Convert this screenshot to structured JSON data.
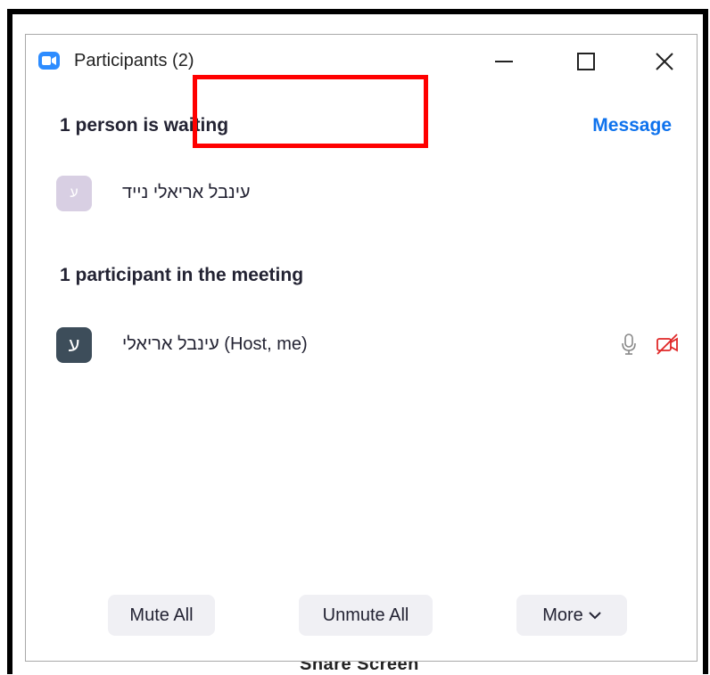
{
  "background_label": "Share Screen",
  "window": {
    "title": "Participants (2)"
  },
  "waiting": {
    "heading": "1 person is waiting",
    "message_label": "Message",
    "participants": [
      {
        "avatar_letter": "ע",
        "name": "עינבל אריאלי נייד"
      }
    ]
  },
  "meeting": {
    "heading": "1 participant in the meeting",
    "participants": [
      {
        "avatar_letter": "ע",
        "name": "עינבל אריאלי (Host, me)",
        "mic": "muted-mic-icon",
        "video": "video-off-icon"
      }
    ]
  },
  "footer": {
    "mute_all": "Mute All",
    "unmute_all": "Unmute All",
    "more": "More"
  },
  "colors": {
    "accent": "#0e72ed",
    "zoom_blue": "#2d8cff",
    "highlight": "#ff0000",
    "video_off": "#e02828"
  }
}
